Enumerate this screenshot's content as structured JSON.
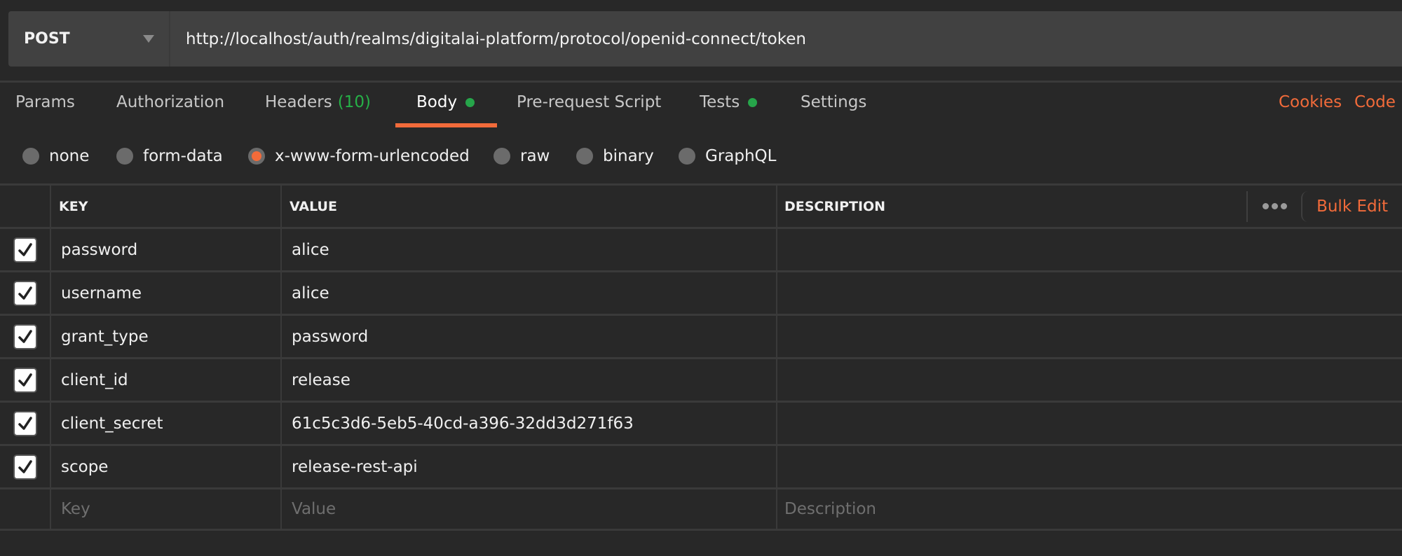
{
  "request": {
    "method": "POST",
    "url": "http://localhost/auth/realms/digitalai-platform/protocol/openid-connect/token"
  },
  "tabs": [
    {
      "label": "Params"
    },
    {
      "label": "Authorization"
    },
    {
      "label": "Headers",
      "count": "(10)"
    },
    {
      "label": "Body",
      "active": true,
      "indicator": "green-dot"
    },
    {
      "label": "Pre-request Script"
    },
    {
      "label": "Tests",
      "indicator": "green-dot"
    },
    {
      "label": "Settings"
    }
  ],
  "links": {
    "cookies": "Cookies",
    "code": "Code"
  },
  "body_types": [
    {
      "label": "none",
      "selected": false
    },
    {
      "label": "form-data",
      "selected": false
    },
    {
      "label": "x-www-form-urlencoded",
      "selected": true
    },
    {
      "label": "raw",
      "selected": false
    },
    {
      "label": "binary",
      "selected": false
    },
    {
      "label": "GraphQL",
      "selected": false
    }
  ],
  "table": {
    "headers": {
      "key": "KEY",
      "value": "VALUE",
      "description": "DESCRIPTION"
    },
    "bulk_edit": "Bulk Edit",
    "rows": [
      {
        "checked": true,
        "key": "password",
        "value": "alice",
        "description": ""
      },
      {
        "checked": true,
        "key": "username",
        "value": "alice",
        "description": ""
      },
      {
        "checked": true,
        "key": "grant_type",
        "value": "password",
        "description": ""
      },
      {
        "checked": true,
        "key": "client_id",
        "value": "release",
        "description": ""
      },
      {
        "checked": true,
        "key": "client_secret",
        "value": "61c5c3d6-5eb5-40cd-a396-32dd3d271f63",
        "description": ""
      },
      {
        "checked": true,
        "key": "scope",
        "value": "release-rest-api",
        "description": ""
      }
    ],
    "placeholders": {
      "key": "Key",
      "value": "Value",
      "description": "Description"
    }
  },
  "colors": {
    "accent": "#f26b3a",
    "indicator_green": "#26a54a",
    "background": "#282828",
    "input_bg": "#414141"
  }
}
